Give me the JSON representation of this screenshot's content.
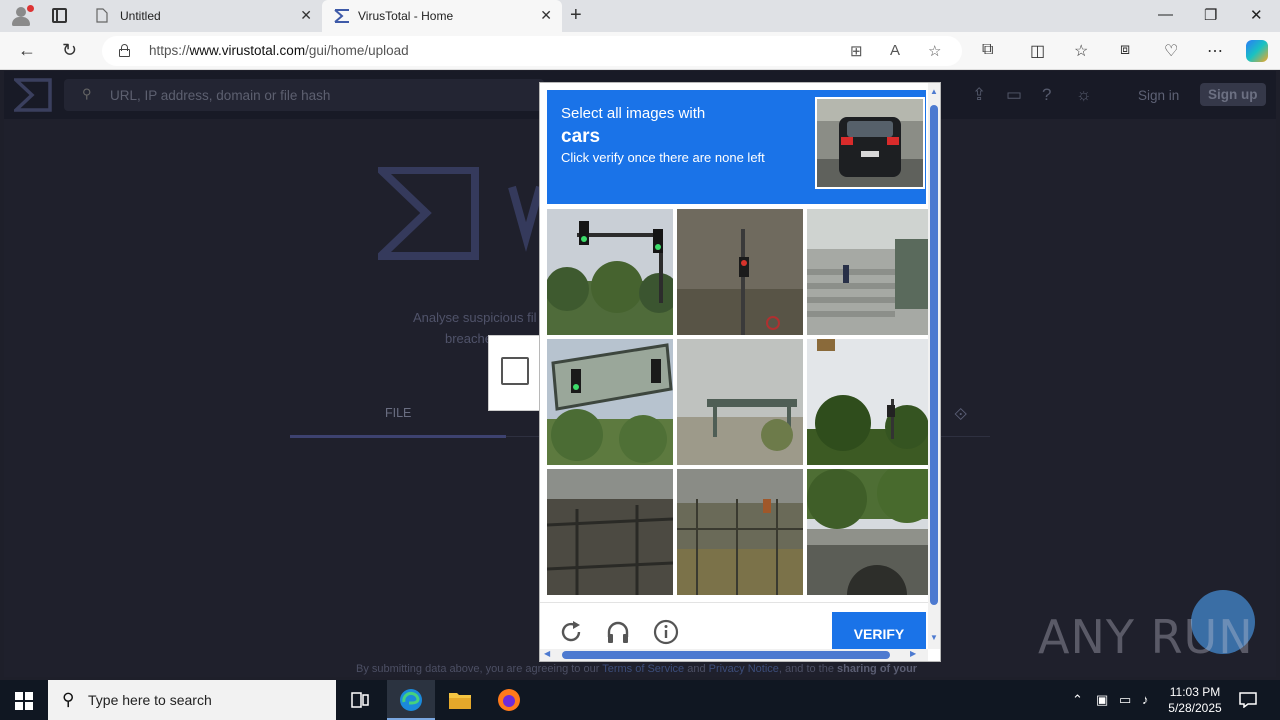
{
  "browser": {
    "tabs": [
      {
        "title": "Untitled",
        "active": false
      },
      {
        "title": "VirusTotal - Home",
        "active": true
      }
    ],
    "url_prefix": "https://",
    "url_host": "www.virustotal.com",
    "url_path": "/gui/home/upload",
    "window_controls": {
      "minimize": "—",
      "restore": "❐",
      "close": "✕"
    }
  },
  "virustotal": {
    "search_placeholder": "URL, IP address, domain or file hash",
    "sign_in": "Sign in",
    "sign_up": "Sign up",
    "tagline_line1": "Analyse suspicious fil",
    "tagline_line2": "breache",
    "tab_file": "FILE",
    "footer_prefix": "By submitting data above, you are agreeing to our ",
    "footer_tos": "Terms of Service",
    "footer_and": " and ",
    "footer_privacy": "Privacy Notice",
    "footer_mid": ", and to the ",
    "footer_sharing": "sharing of your"
  },
  "captcha": {
    "instruction": "Select all images with",
    "target": "cars",
    "subtext": "Click verify once there are none left",
    "verify_label": "VERIFY",
    "tiles": [
      {
        "subject": "traffic lights over trees"
      },
      {
        "subject": "traffic light pole with sign"
      },
      {
        "subject": "building stairs with person"
      },
      {
        "subject": "traffic light on gantry"
      },
      {
        "subject": "pedestrian bridge over road"
      },
      {
        "subject": "trees with traffic light"
      },
      {
        "subject": "fence with foliage"
      },
      {
        "subject": "fence along road"
      },
      {
        "subject": "stone bridge with trees"
      }
    ]
  },
  "watermark": {
    "text": "ANY RUN"
  },
  "taskbar": {
    "search_placeholder": "Type here to search",
    "time": "11:03 PM",
    "date": "5/28/2025"
  },
  "colors": {
    "captcha_blue": "#1a73e8",
    "vt_background": "#1f202c"
  }
}
